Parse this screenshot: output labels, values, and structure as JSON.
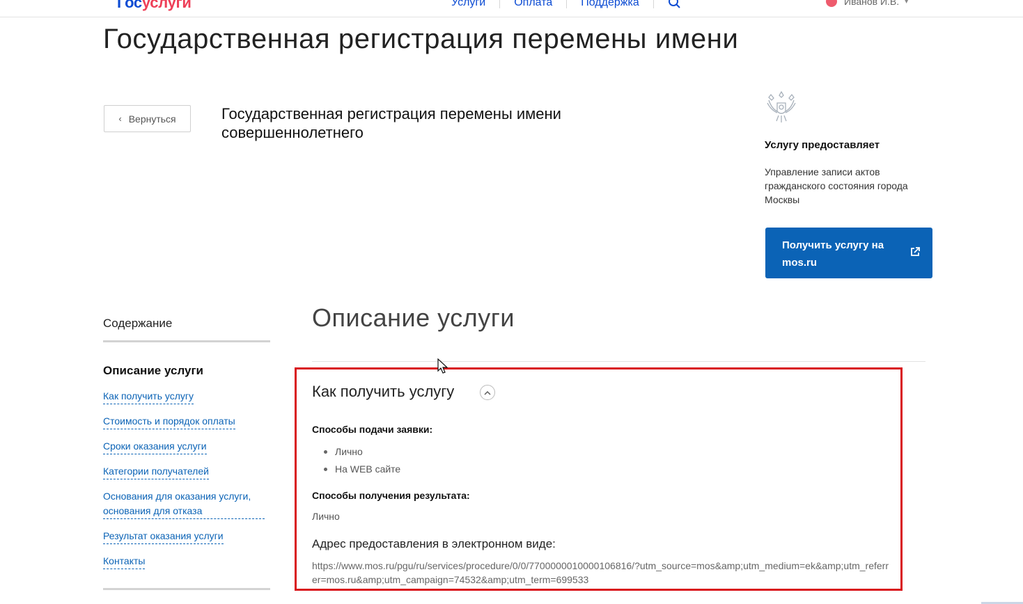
{
  "header": {
    "logo_part1": "Гос",
    "logo_part2": "услуги",
    "nav": [
      "Услуги",
      "Оплата",
      "Поддержка"
    ],
    "user_name": "Иванов И.В."
  },
  "page": {
    "title": "Государственная регистрация перемены имени",
    "back_label": "Вернуться",
    "service_title": "Государственная регистрация перемены имени совершеннолетнего"
  },
  "provider": {
    "label": "Услугу предоставляет",
    "name": "Управление записи актов гражданского состояния города Москвы",
    "button_label": "Получить услугу на mos.ru"
  },
  "toc": {
    "heading": "Содержание",
    "active": "Описание услуги",
    "links": [
      "Как получить услугу",
      "Стоимость и порядок оплаты",
      "Сроки оказания услуги",
      "Категории получателей",
      "Основания для оказания услуги, основания для отказа",
      "Результат оказания услуги",
      "Контакты"
    ]
  },
  "content": {
    "section_title": "Описание услуги",
    "howto_title": "Как получить услугу",
    "submit_methods_label": "Способы подачи заявки:",
    "submit_methods": [
      "Лично",
      "На WEB сайте"
    ],
    "result_methods_label": "Способы получения результата:",
    "result_method": "Лично",
    "address_label": "Адрес предоставления в электронном виде:",
    "address_url": "https://www.mos.ru/pgu/ru/services/procedure/0/0/7700000010000106816/?utm_source=mos&amp;utm_medium=ek&amp;utm_referrer=mos.ru&amp;utm_campaign=74532&amp;utm_term=699533"
  },
  "colors": {
    "link": "#0b63b6",
    "button": "#0b63b6",
    "highlight": "#d9151b",
    "brand_blue": "#0d4cd3",
    "brand_red": "#ee3f58"
  }
}
